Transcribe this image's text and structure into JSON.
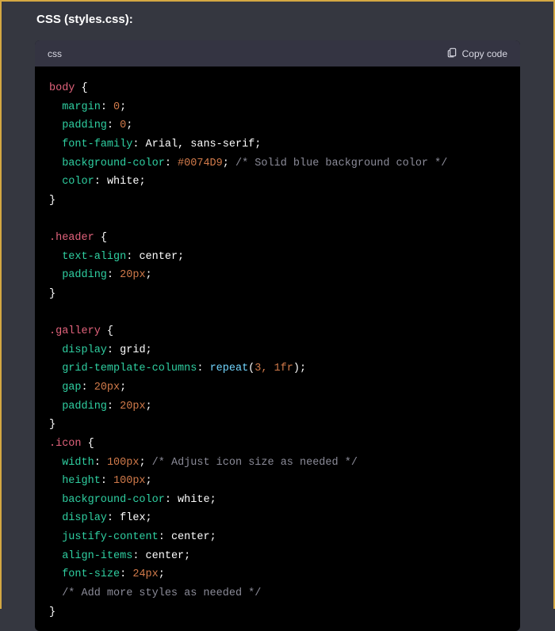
{
  "header": {
    "title": "CSS (styles.css):"
  },
  "code": {
    "lang_label": "css",
    "copy_label": "Copy code",
    "rules": [
      {
        "selector": "body",
        "decls": [
          {
            "prop": "margin",
            "value": "0",
            "value_kind": "num"
          },
          {
            "prop": "padding",
            "value": "0",
            "value_kind": "num"
          },
          {
            "prop": "font-family",
            "value": "Arial, sans-serif",
            "value_kind": "plain"
          },
          {
            "prop": "background-color",
            "value": "#0074D9",
            "value_kind": "num",
            "comment": "/* Solid blue background color */"
          },
          {
            "prop": "color",
            "value": "white",
            "value_kind": "plain"
          }
        ],
        "blank_after": true
      },
      {
        "selector": ".header",
        "decls": [
          {
            "prop": "text-align",
            "value": "center",
            "value_kind": "plain"
          },
          {
            "prop": "padding",
            "value": "20px",
            "value_kind": "num"
          }
        ],
        "blank_after": true
      },
      {
        "selector": ".gallery",
        "decls": [
          {
            "prop": "display",
            "value": "grid",
            "value_kind": "plain"
          },
          {
            "prop": "grid-template-columns",
            "func": "repeat",
            "args": "3, 1fr"
          },
          {
            "prop": "gap",
            "value": "20px",
            "value_kind": "num"
          },
          {
            "prop": "padding",
            "value": "20px",
            "value_kind": "num"
          }
        ],
        "blank_after": false
      },
      {
        "selector": ".icon",
        "decls": [
          {
            "prop": "width",
            "value": "100px",
            "value_kind": "num",
            "comment": "/* Adjust icon size as needed */"
          },
          {
            "prop": "height",
            "value": "100px",
            "value_kind": "num"
          },
          {
            "prop": "background-color",
            "value": "white",
            "value_kind": "plain"
          },
          {
            "prop": "display",
            "value": "flex",
            "value_kind": "plain"
          },
          {
            "prop": "justify-content",
            "value": "center",
            "value_kind": "plain"
          },
          {
            "prop": "align-items",
            "value": "center",
            "value_kind": "plain"
          },
          {
            "prop": "font-size",
            "value": "24px",
            "value_kind": "num"
          },
          {
            "comment_only": "/* Add more styles as needed */"
          }
        ],
        "blank_after": false
      }
    ]
  }
}
